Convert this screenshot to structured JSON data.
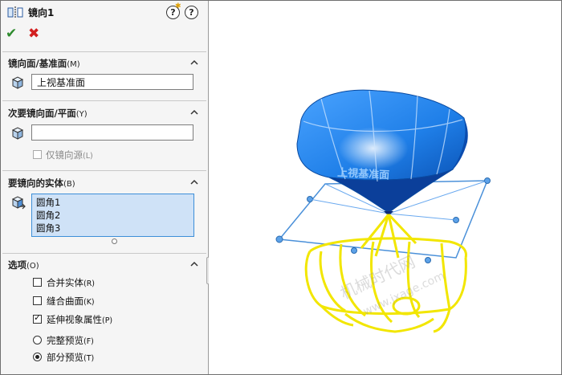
{
  "feature": {
    "title": "镜向1",
    "help_left": "?",
    "help_right": "?"
  },
  "actions": {
    "ok_icon": "check-icon",
    "cancel_icon": "x-icon"
  },
  "mirror_face": {
    "title": "镜向面/基准面",
    "hotkey": "(M)",
    "value": "上视基准面"
  },
  "secondary_face": {
    "title": "次要镜向面/平面",
    "hotkey": "(Y)",
    "value": "",
    "only_source_label": "仅镜向源",
    "only_source_hotkey": "(L)",
    "only_source_checked": false
  },
  "bodies": {
    "title": "要镜向的实体",
    "hotkey": "(B)",
    "items": [
      "圆角1",
      "圆角2",
      "圆角3"
    ]
  },
  "options": {
    "title": "选项",
    "hotkey": "(O)",
    "merge_label": "合并实体",
    "merge_hotkey": "(R)",
    "merge_checked": false,
    "knit_label": "缝合曲面",
    "knit_hotkey": "(K)",
    "knit_checked": false,
    "propagate_label": "延伸视象属性",
    "propagate_hotkey": "(P)",
    "propagate_checked": true,
    "full_preview_label": "完整预览",
    "full_preview_hotkey": "(F)",
    "partial_preview_label": "部分预览",
    "partial_preview_hotkey": "(T)",
    "preview_mode": "partial"
  },
  "viewport": {
    "model_text": "上視基准面",
    "watermark_cn": "机械时代网",
    "watermark_url": "www.jxage.com"
  },
  "colors": {
    "body": "#1f7fe8",
    "preview": "#f2e600",
    "plane": "#4a90d9",
    "ok": "#2e8b2e",
    "cancel": "#d21f1f"
  }
}
